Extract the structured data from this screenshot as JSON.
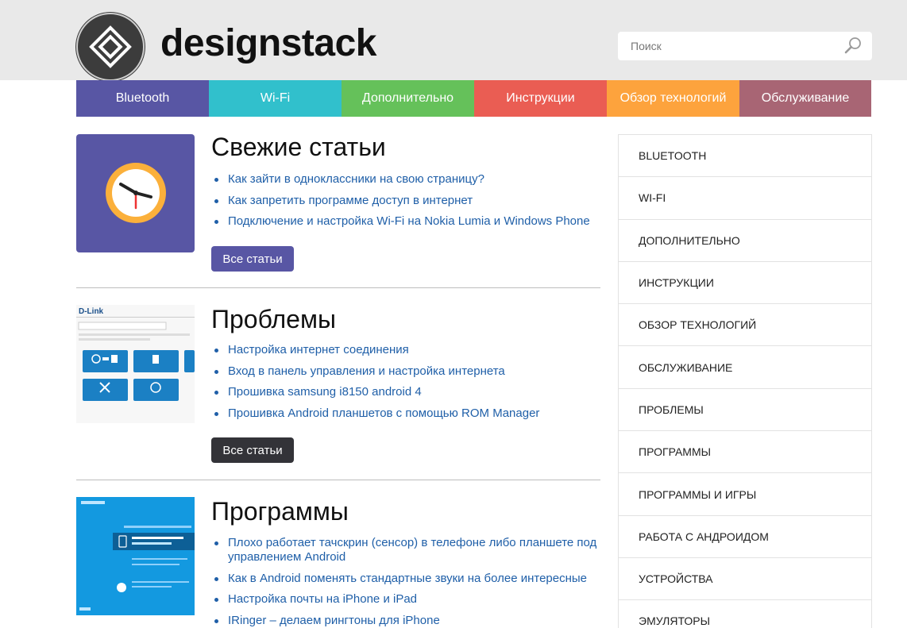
{
  "header": {
    "site_name": "designstack",
    "search_placeholder": "Поиск",
    "search_value": ""
  },
  "nav": {
    "items": [
      {
        "label": "Bluetooth",
        "color": "#5856a4"
      },
      {
        "label": "Wi-Fi",
        "color": "#31c0cc"
      },
      {
        "label": "Дополнительно",
        "color": "#65c15a"
      },
      {
        "label": "Инструкции",
        "color": "#ea5d53"
      },
      {
        "label": "Обзор технологий",
        "color": "#fda33d"
      },
      {
        "label": "Обслуживание",
        "color": "#a86574"
      }
    ]
  },
  "blocks": [
    {
      "title": "Свежие статьи",
      "links": [
        "Как зайти в одноклассники на свою страницу?",
        "Как запретить программе доступ в интернет",
        "Подключение и настройка Wi-Fi на Nokia Lumia и Windows Phone"
      ],
      "button_label": "Все статьи",
      "button_color": "#5856a4"
    },
    {
      "title": "Проблемы",
      "thumb_text": "D-Link",
      "links": [
        "Настройка интернет соединения",
        "Вход в панель управления и настройка интернета",
        "Прошивка samsung i8150 android 4",
        "Прошивка Android планшетов с помощью ROM Manager"
      ],
      "button_label": "Все статьи",
      "button_color": "#333338"
    },
    {
      "title": "Программы",
      "links": [
        "Плохо работает тачскрин (сенсор) в телефоне либо планшете под управлением Android",
        "Как в Android поменять стандартные звуки на более интересные",
        "Настройка почты на iPhone и iPad",
        "IRinger – делаем рингтоны для iPhone"
      ]
    }
  ],
  "sidebar": {
    "items": [
      "BLUETOOTH",
      "WI-FI",
      "ДОПОЛНИТЕЛЬНО",
      "ИНСТРУКЦИИ",
      "ОБЗОР ТЕХНОЛОГИЙ",
      "ОБСЛУЖИВАНИЕ",
      "ПРОБЛЕМЫ",
      "ПРОГРАММЫ",
      "ПРОГРАММЫ И ИГРЫ",
      "РАБОТА С АНДРОИДОМ",
      "УСТРОЙСТВА",
      "ЭМУЛЯТОРЫ"
    ]
  },
  "icons": {
    "logo": "diamond-logo-icon",
    "search": "search-icon",
    "clock": "clock-icon"
  },
  "colors": {
    "header_bg": "#e9e9e9",
    "link": "#1f5fa8",
    "clock_face": "#fbb03b",
    "thumb_purple": "#5856a4",
    "thumb_blue": "#1399e0"
  }
}
